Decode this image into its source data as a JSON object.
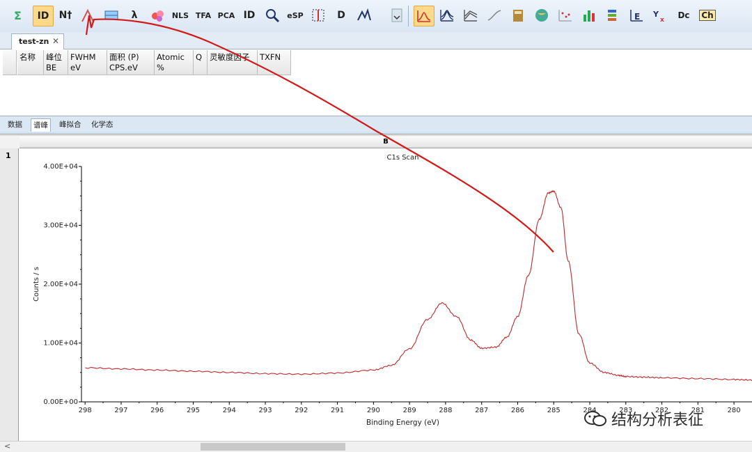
{
  "toolbar": {
    "buttons": [
      {
        "name": "sum-tool-button",
        "label": "",
        "icon": "sigma-icon"
      },
      {
        "name": "id-button",
        "label": "ID",
        "icon": "id-icon",
        "active": true
      },
      {
        "name": "nt-button",
        "label": "N†",
        "icon": "peak-n-icon"
      },
      {
        "name": "peak-mark-button",
        "label": "",
        "icon": "peak-icon"
      },
      {
        "name": "table-button",
        "label": "",
        "icon": "table-icon"
      },
      {
        "name": "lambda-button",
        "label": "λ",
        "icon": "lambda-icon"
      },
      {
        "name": "atoms-button",
        "label": "",
        "icon": "atoms-icon"
      },
      {
        "name": "nls-button",
        "label": "NLS",
        "icon": "nls-icon"
      },
      {
        "name": "tfa-button",
        "label": "TFA",
        "icon": "tfa-icon"
      },
      {
        "name": "pca-button",
        "label": "PCA",
        "icon": "pca-icon"
      },
      {
        "name": "id-gear-button",
        "label": "ID",
        "icon": "id-gear-icon"
      },
      {
        "name": "search-peak-button",
        "label": "",
        "icon": "magnifier-icon"
      },
      {
        "name": "esp-button",
        "label": "eSP",
        "icon": "esp-icon"
      },
      {
        "name": "bracket-button",
        "label": "",
        "icon": "bracket-icon"
      },
      {
        "name": "d-button",
        "label": "D",
        "icon": "d-icon"
      },
      {
        "name": "spectrum-edit-button",
        "label": "",
        "icon": "spectrum-edit-icon"
      }
    ],
    "buttons2": [
      {
        "name": "spectrum-view-button",
        "label": "",
        "icon": "spectrum-icon",
        "active": true
      },
      {
        "name": "overlay-button",
        "label": "",
        "icon": "overlay-icon"
      },
      {
        "name": "stack-button",
        "label": "",
        "icon": "stack-icon"
      },
      {
        "name": "curve-button",
        "label": "",
        "icon": "curve-icon"
      },
      {
        "name": "book-button",
        "label": "",
        "icon": "book-icon"
      },
      {
        "name": "globe-button",
        "label": "",
        "icon": "globe-icon"
      },
      {
        "name": "scatter-button",
        "label": "",
        "icon": "scatter-icon"
      },
      {
        "name": "bar-button",
        "label": "",
        "icon": "bar-chart-icon"
      },
      {
        "name": "palette-button",
        "label": "",
        "icon": "palette-icon"
      },
      {
        "name": "energy-button",
        "label": "",
        "icon": "energy-icon"
      },
      {
        "name": "yx-button",
        "label": "",
        "icon": "yx-icon"
      },
      {
        "name": "dc-button",
        "label": "Dc",
        "icon": "dc-icon"
      },
      {
        "name": "ch-button",
        "label": "Ch",
        "icon": "ch-icon"
      }
    ]
  },
  "tab": {
    "label": "test-zn",
    "close": "✕"
  },
  "peak_table": {
    "headers": [
      "名称",
      "峰位\nBE",
      "FWHM\neV",
      "面积 (P)\nCPS.eV",
      "Atomic\n%",
      "Q",
      "灵敏度因子",
      "TXFN"
    ]
  },
  "subtabs": [
    "数据",
    "谱峰",
    "峰拟合",
    "化学态"
  ],
  "chart_header": {
    "column": "B",
    "row": "1"
  },
  "chart_data": {
    "type": "line",
    "title": "C1s Scan",
    "xlabel": "Binding Energy (eV)",
    "ylabel": "Counts / s",
    "xlim": [
      298.1,
      279.5
    ],
    "ylim": [
      0,
      40000
    ],
    "x_ticks": [
      "298",
      "297",
      "296",
      "295",
      "294",
      "293",
      "292",
      "291",
      "290",
      "289",
      "288",
      "287",
      "286",
      "285",
      "284",
      "283",
      "282",
      "281",
      "280"
    ],
    "y_ticks": [
      "0.00E+00",
      "1.00E+04",
      "2.00E+04",
      "3.00E+04",
      "4.00E+04"
    ],
    "series": [
      {
        "color": "#c0282a",
        "x": [
          298,
          297,
          296,
          295,
          294,
          293,
          292,
          291,
          290,
          289.5,
          289,
          288.5,
          288.1,
          287.7,
          287.3,
          287,
          286.6,
          286.3,
          286,
          285.7,
          285.4,
          285.15,
          285,
          284.8,
          284.6,
          284.3,
          284,
          283.6,
          283.2,
          283,
          282.5,
          282,
          281,
          280,
          279.5
        ],
        "y": [
          5800,
          5600,
          5400,
          5200,
          5000,
          4800,
          4700,
          4900,
          5400,
          6200,
          9000,
          14000,
          16800,
          14500,
          10500,
          9100,
          9300,
          11000,
          14500,
          21500,
          31000,
          35500,
          35800,
          33000,
          24000,
          11500,
          6600,
          5000,
          4500,
          4300,
          4200,
          4100,
          3950,
          3800,
          3700
        ]
      }
    ]
  },
  "watermark": "结构分析表征",
  "colors": {
    "accent": "#ffd98a",
    "curve": "#c0282a",
    "annotation": "#d11a1a"
  }
}
